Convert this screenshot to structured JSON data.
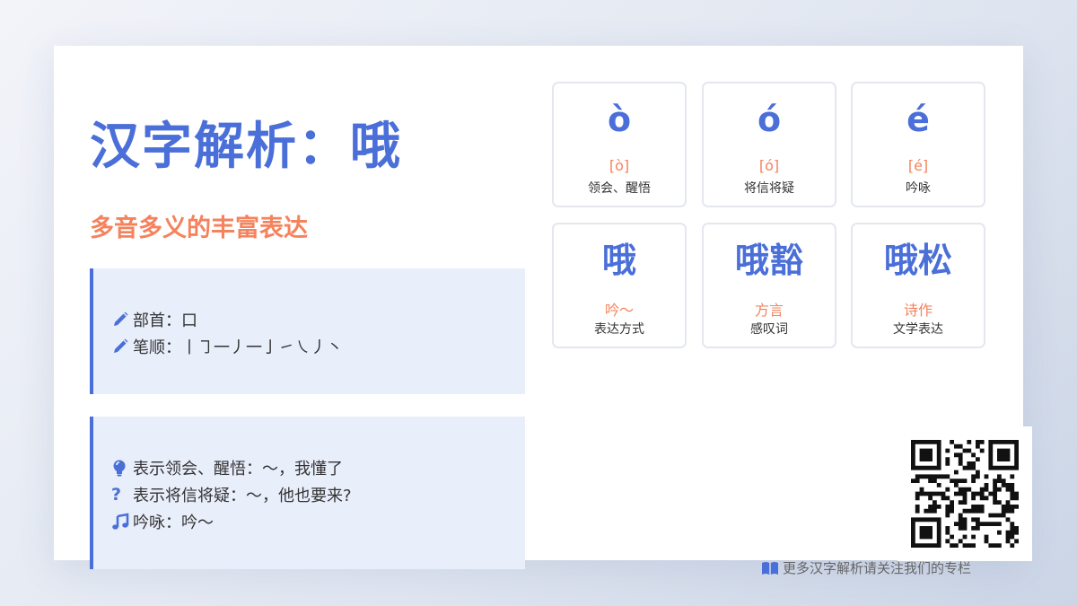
{
  "title": "汉字解析：哦",
  "subtitle": "多音多义的丰富表达",
  "info_basic": [
    {
      "icon": "pencil-icon",
      "text": "部首：口"
    },
    {
      "icon": "pencil-icon",
      "text": "笔顺：丨㇆一丿一亅㇀㇏丿丶"
    }
  ],
  "info_usage": [
    {
      "icon": "lightbulb-icon",
      "text": "表示领会、醒悟：～，我懂了"
    },
    {
      "icon": "question-icon",
      "text": "表示将信将疑：～，他也要来?"
    },
    {
      "icon": "music-note-icon",
      "text": "吟咏：吟～"
    }
  ],
  "pronunciations": [
    {
      "big": "ò",
      "pinyin": "[ò]",
      "meaning": "领会、醒悟"
    },
    {
      "big": "ó",
      "pinyin": "[ó]",
      "meaning": "将信将疑"
    },
    {
      "big": "é",
      "pinyin": "[é]",
      "meaning": "吟咏"
    }
  ],
  "words": [
    {
      "big": "哦",
      "pinyin": "吟～",
      "meaning": "表达方式"
    },
    {
      "big": "哦豁",
      "pinyin": "方言",
      "meaning": "感叹词"
    },
    {
      "big": "哦松",
      "pinyin": "诗作",
      "meaning": "文学表达"
    }
  ],
  "footer": {
    "icon": "book-icon",
    "text": "更多汉字解析请关注我们的专栏"
  },
  "colors": {
    "accent": "#4a6fd8",
    "highlight": "#f5825c",
    "panel": "#e9eefb"
  }
}
